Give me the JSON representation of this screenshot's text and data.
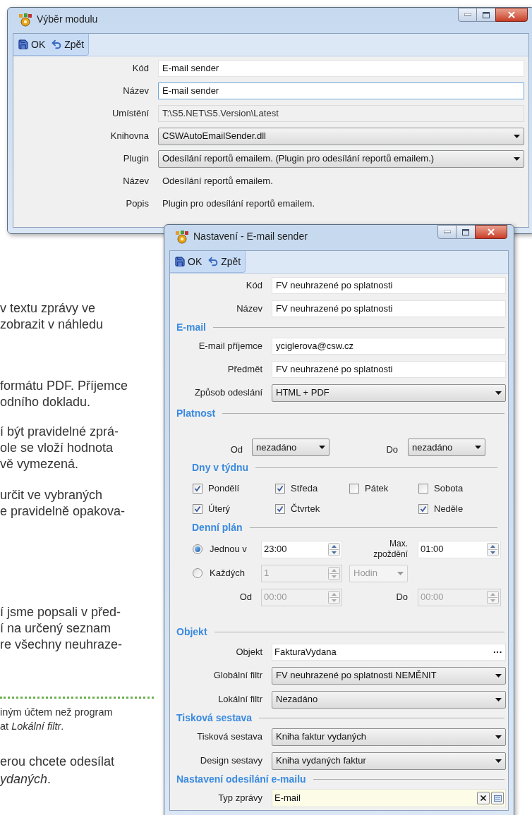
{
  "document": {
    "paragraphs": [
      {
        "lines": [
          "v textu zprávy ve",
          "zobrazit v náhledu"
        ]
      },
      {
        "lines": [
          "formátu PDF. Příjemce",
          "odního dokladu."
        ]
      },
      {
        "lines": [
          "í být pravidelné zprá-",
          "ole se vloží hodnota",
          "vě vymezená."
        ]
      },
      {
        "lines": [
          "určit ve vybraných",
          "e pravidelně opakova-"
        ]
      },
      {
        "lines": [
          "í jsme popsali v před-",
          "í na určený seznam",
          "re všechny neuhraze-"
        ]
      }
    ],
    "note": {
      "lines": [
        "iným účtem než program",
        "at *Lokální filtr*."
      ]
    },
    "closing": {
      "lines": [
        "erou chcete odesílat",
        "*ydaných*."
      ]
    }
  },
  "module_window": {
    "title": "Výběr modulu",
    "toolbar": [
      {
        "kind": "save",
        "label": "OK"
      },
      {
        "kind": "undo",
        "label": "Zpět"
      }
    ],
    "fields": [
      {
        "kind": "text",
        "label": "Kód",
        "value": "E-mail sender",
        "focused": false
      },
      {
        "kind": "text",
        "label": "Název",
        "value": "E-mail sender",
        "focused": true
      },
      {
        "kind": "readonly",
        "label": "Umístění",
        "value": "T:\\S5.NET\\S5.Version\\Latest"
      },
      {
        "kind": "dropdown",
        "label": "Knihovna",
        "value": "CSWAutoEmailSender.dll"
      },
      {
        "kind": "dropdown",
        "label": "Plugin",
        "value": "Odesílání reportů emailem. (Plugin pro odesílání reportů emailem.)"
      },
      {
        "kind": "plain",
        "label": "Název",
        "value": "Odesílání reportů emailem."
      },
      {
        "kind": "plain",
        "label": "Popis",
        "value": "Plugin pro odesílání reportů emailem."
      }
    ]
  },
  "settings_window": {
    "title": "Nastavení - E-mail sender",
    "toolbar": [
      {
        "kind": "save",
        "label": "OK"
      },
      {
        "kind": "undo",
        "label": "Zpět"
      }
    ],
    "rows": [
      {
        "kind": "text",
        "label": "Kód",
        "value": "FV neuhrazené po splatnosti"
      },
      {
        "kind": "text",
        "label": "Název",
        "value": "FV neuhrazené po splatnosti"
      },
      {
        "kind": "section",
        "title": "E-mail"
      },
      {
        "kind": "text",
        "label": "E-mail příjemce",
        "value": "yciglerova@csw.cz"
      },
      {
        "kind": "text",
        "label": "Předmět",
        "value": "FV neuhrazené po splatnosti"
      },
      {
        "kind": "dropdown",
        "label": "Způsob odeslání",
        "value": "HTML + PDF"
      },
      {
        "kind": "section",
        "title": "Platnost"
      },
      {
        "kind": "range",
        "items": [
          {
            "label": "Od",
            "value": "nezadáno"
          },
          {
            "label": "Do",
            "value": "nezadáno"
          }
        ]
      },
      {
        "kind": "subsection",
        "title": "Dny v týdnu"
      },
      {
        "kind": "days",
        "columns": [
          [
            {
              "label": "Pondělí",
              "checked": true
            },
            {
              "label": "Úterý",
              "checked": true
            }
          ],
          [
            {
              "label": "Středa",
              "checked": true
            },
            {
              "label": "Čtvrtek",
              "checked": true
            }
          ],
          [
            {
              "label": "Pátek",
              "checked": false
            }
          ],
          [
            {
              "label": "Sobota",
              "checked": false
            },
            {
              "label": "Neděle",
              "checked": true
            }
          ]
        ]
      },
      {
        "kind": "subsection",
        "title": "Denní plán"
      },
      {
        "kind": "schedule",
        "options": [
          {
            "label": "Jednou v",
            "value": "23:00",
            "selected": true
          },
          {
            "label": "Každých",
            "value": "1",
            "unit": "Hodin",
            "selected": false
          }
        ],
        "delay": {
          "label_lines": [
            "Max.",
            "zpoždění"
          ],
          "value": "01:00"
        },
        "window": [
          {
            "label": "Od",
            "value": "00:00"
          },
          {
            "label": "Do",
            "value": "00:00"
          }
        ]
      },
      {
        "kind": "section",
        "title": "Objekt"
      },
      {
        "kind": "lookup",
        "label": "Objekt",
        "value": "FakturaVydana",
        "button": "···"
      },
      {
        "kind": "dropdown",
        "label": "Globální filtr",
        "value": "FV neuhrazené po splatnosti NEMĚNIT"
      },
      {
        "kind": "dropdown",
        "label": "Lokální filtr",
        "value": "Nezadáno"
      },
      {
        "kind": "section",
        "title": "Tisková sestava"
      },
      {
        "kind": "dropdown",
        "label": "Tisková sestava",
        "value": "Kniha faktur vydaných"
      },
      {
        "kind": "dropdown",
        "label": "Design sestavy",
        "value": "Kniha vydaných faktur"
      },
      {
        "kind": "section",
        "title": "Nastavení odesílání e-mailu"
      },
      {
        "kind": "typed",
        "label": "Typ zprávy",
        "value": "E-mail"
      }
    ]
  }
}
